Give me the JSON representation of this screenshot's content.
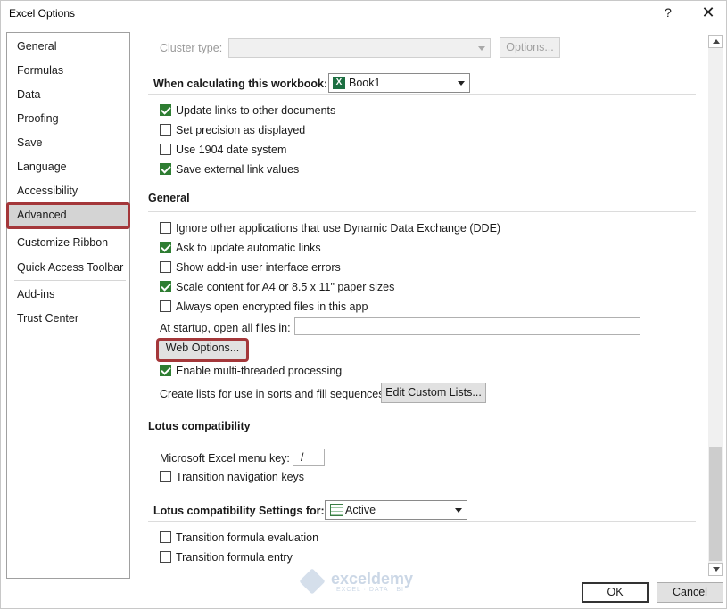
{
  "window": {
    "title": "Excel Options",
    "help_glyph": "?",
    "close_glyph": "✕"
  },
  "sidebar": {
    "items": [
      {
        "label": "General"
      },
      {
        "label": "Formulas"
      },
      {
        "label": "Data"
      },
      {
        "label": "Proofing"
      },
      {
        "label": "Save"
      },
      {
        "label": "Language"
      },
      {
        "label": "Accessibility"
      },
      {
        "label": "Advanced"
      },
      {
        "label": "Customize Ribbon"
      },
      {
        "label": "Quick Access Toolbar"
      },
      {
        "label": "Add-ins"
      },
      {
        "label": "Trust Center"
      }
    ],
    "selected": "Advanced"
  },
  "cluster": {
    "label": "Cluster type:",
    "value": "",
    "options_button": "Options..."
  },
  "calc_workbook": {
    "heading": "When calculating this workbook:",
    "workbook": "Book1",
    "options": [
      {
        "label": "Update links to other documents",
        "checked": true
      },
      {
        "label": "Set precision as displayed",
        "checked": false
      },
      {
        "label": "Use 1904 date system",
        "checked": false
      },
      {
        "label": "Save external link values",
        "checked": true
      }
    ]
  },
  "general": {
    "heading": "General",
    "options": [
      {
        "label": "Ignore other applications that use Dynamic Data Exchange (DDE)",
        "checked": false
      },
      {
        "label": "Ask to update automatic links",
        "checked": true
      },
      {
        "label": "Show add-in user interface errors",
        "checked": false
      },
      {
        "label": "Scale content for A4 or 8.5 x 11\" paper sizes",
        "checked": true
      },
      {
        "label": "Always open encrypted files in this app",
        "checked": false
      }
    ],
    "startup_label": "At startup, open all files in:",
    "startup_value": "",
    "web_options_button": "Web Options...",
    "multithread": {
      "label": "Enable multi-threaded processing",
      "checked": true
    },
    "custom_lists_label": "Create lists for use in sorts and fill sequences:",
    "custom_lists_button": "Edit Custom Lists..."
  },
  "lotus": {
    "heading": "Lotus compatibility",
    "menu_key_label": "Microsoft Excel menu key:",
    "menu_key_value": "/",
    "nav_keys": {
      "label": "Transition navigation keys",
      "checked": false
    }
  },
  "lotus_settings": {
    "heading": "Lotus compatibility Settings for:",
    "sheet": "Active",
    "options": [
      {
        "label": "Transition formula evaluation",
        "checked": false
      },
      {
        "label": "Transition formula entry",
        "checked": false
      }
    ]
  },
  "footer": {
    "ok": "OK",
    "cancel": "Cancel"
  },
  "watermark": {
    "name": "exceldemy",
    "tagline": "EXCEL · DATA · BI"
  },
  "colors": {
    "highlight": "#a4373a",
    "check": "#2e7d32",
    "excel_green": "#1d6f42"
  }
}
